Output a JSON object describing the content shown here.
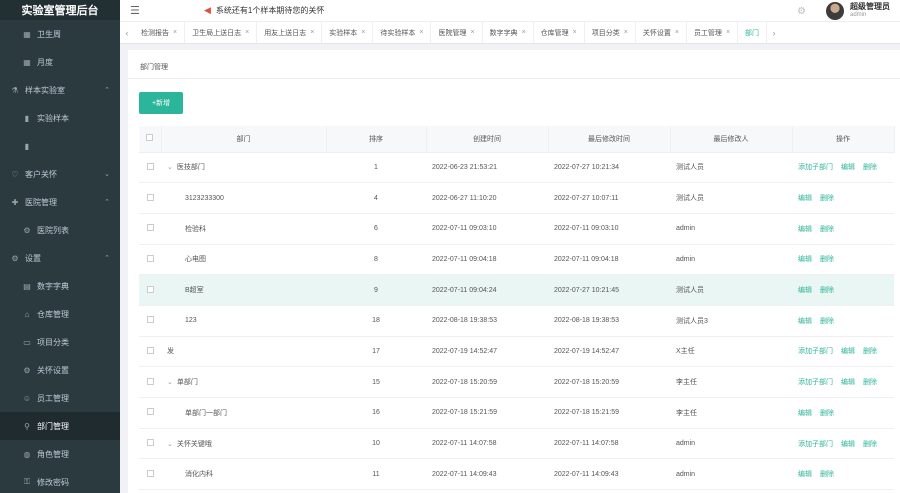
{
  "app_title": "实验室管理后台",
  "sidebar": {
    "items": [
      {
        "label": "卫生周",
        "sub": true,
        "icon": "calendar-icon"
      },
      {
        "label": "月度",
        "sub": true,
        "icon": "calendar-icon"
      },
      {
        "label": "样本实验室",
        "sub": false,
        "icon": "flask-icon",
        "arrow": "^"
      },
      {
        "label": "实验样本",
        "sub": true,
        "icon": "tube-icon"
      },
      {
        "label": "",
        "sub": true,
        "icon": "tube-icon"
      },
      {
        "label": "客户关怀",
        "sub": false,
        "icon": "heart-icon",
        "arrow": "v"
      },
      {
        "label": "医院管理",
        "sub": false,
        "icon": "hospital-icon",
        "arrow": "^"
      },
      {
        "label": "医院列表",
        "sub": true,
        "icon": "gear-icon"
      },
      {
        "label": "设置",
        "sub": false,
        "icon": "gear-icon",
        "arrow": "^"
      },
      {
        "label": "数字字典",
        "sub": true,
        "icon": "book-icon"
      },
      {
        "label": "仓库管理",
        "sub": true,
        "icon": "warehouse-icon"
      },
      {
        "label": "项目分类",
        "sub": true,
        "icon": "folder-icon"
      },
      {
        "label": "关怀设置",
        "sub": true,
        "icon": "settings-icon"
      },
      {
        "label": "员工管理",
        "sub": true,
        "icon": "user-icon"
      },
      {
        "label": "部门管理",
        "sub": true,
        "icon": "org-icon",
        "active": true
      },
      {
        "label": "角色管理",
        "sub": true,
        "icon": "role-icon"
      },
      {
        "label": "修改密码",
        "sub": true,
        "icon": "lock-icon"
      }
    ]
  },
  "topbar": {
    "notice": "系统还有1个样本期待您的关怀",
    "user_name": "超级管理员",
    "user_role": "admin"
  },
  "tabs": [
    {
      "label": "检测报告",
      "closable": true
    },
    {
      "label": "卫生局上送日志",
      "closable": true
    },
    {
      "label": "用友上送日志",
      "closable": true
    },
    {
      "label": "实验样本",
      "closable": true
    },
    {
      "label": "待实验样本",
      "closable": true
    },
    {
      "label": "医院管理",
      "closable": true
    },
    {
      "label": "数字字典",
      "closable": true
    },
    {
      "label": "仓库管理",
      "closable": true
    },
    {
      "label": "项目分类",
      "closable": true
    },
    {
      "label": "关怀设置",
      "closable": true
    },
    {
      "label": "员工管理",
      "closable": true
    },
    {
      "label": "部门",
      "closable": false,
      "active": true
    }
  ],
  "page": {
    "breadcrumb": "部门管理",
    "add_button": "+新增"
  },
  "table": {
    "columns": [
      "",
      "部门",
      "排序",
      "创建时间",
      "最后修改时间",
      "最后修改人",
      "操作"
    ],
    "rows": [
      {
        "name": "医技部门",
        "level": 0,
        "expand": true,
        "sort": "1",
        "created": "2022-06-23 21:53:21",
        "modified": "2022-07-27 10:21:34",
        "modifier": "测试人员",
        "actions": [
          "添加子部门",
          "编辑",
          "删除"
        ]
      },
      {
        "name": "3123233300",
        "level": 1,
        "expand": false,
        "sort": "4",
        "created": "2022-06-27 11:10:20",
        "modified": "2022-07-27 10:07:11",
        "modifier": "测试人员",
        "actions": [
          "编辑",
          "删除"
        ]
      },
      {
        "name": "检验科",
        "level": 1,
        "expand": false,
        "sort": "6",
        "created": "2022-07-11 09:03:10",
        "modified": "2022-07-11 09:03:10",
        "modifier": "admin",
        "actions": [
          "编辑",
          "删除"
        ]
      },
      {
        "name": "心电图",
        "level": 1,
        "expand": false,
        "sort": "8",
        "created": "2022-07-11 09:04:18",
        "modified": "2022-07-11 09:04:18",
        "modifier": "admin",
        "actions": [
          "编辑",
          "删除"
        ]
      },
      {
        "name": "B超室",
        "level": 1,
        "expand": false,
        "sort": "9",
        "created": "2022-07-11 09:04:24",
        "modified": "2022-07-27 10:21:45",
        "modifier": "测试人员",
        "actions": [
          "编辑",
          "删除"
        ],
        "highlight": true
      },
      {
        "name": "123",
        "level": 1,
        "expand": false,
        "sort": "18",
        "created": "2022-08-18 19:38:53",
        "modified": "2022-08-18 19:38:53",
        "modifier": "测试人员3",
        "actions": [
          "编辑",
          "删除"
        ]
      },
      {
        "name": "发",
        "level": 0,
        "expand": false,
        "sort": "17",
        "created": "2022-07-19 14:52:47",
        "modified": "2022-07-19 14:52:47",
        "modifier": "X主任",
        "actions": [
          "添加子部门",
          "编辑",
          "删除"
        ]
      },
      {
        "name": "单部门",
        "level": 0,
        "expand": true,
        "sort": "15",
        "created": "2022-07-18 15:20:59",
        "modified": "2022-07-18 15:20:59",
        "modifier": "李主任",
        "actions": [
          "添加子部门",
          "编辑",
          "删除"
        ]
      },
      {
        "name": "单部门一部门",
        "level": 1,
        "expand": false,
        "sort": "16",
        "created": "2022-07-18 15:21:59",
        "modified": "2022-07-18 15:21:59",
        "modifier": "李主任",
        "actions": [
          "编辑",
          "删除"
        ]
      },
      {
        "name": "关怀关键哦",
        "level": 0,
        "expand": true,
        "sort": "10",
        "created": "2022-07-11 14:07:58",
        "modified": "2022-07-11 14:07:58",
        "modifier": "admin",
        "actions": [
          "添加子部门",
          "编辑",
          "删除"
        ]
      },
      {
        "name": "消化内科",
        "level": 1,
        "expand": false,
        "sort": "11",
        "created": "2022-07-11 14:09:43",
        "modified": "2022-07-11 14:09:43",
        "modifier": "admin",
        "actions": [
          "编辑",
          "删除"
        ]
      }
    ]
  },
  "colors": {
    "accent": "#2bb59a",
    "sidebar": "#2b3a3f",
    "highlight_row": "#e9f6f3"
  }
}
